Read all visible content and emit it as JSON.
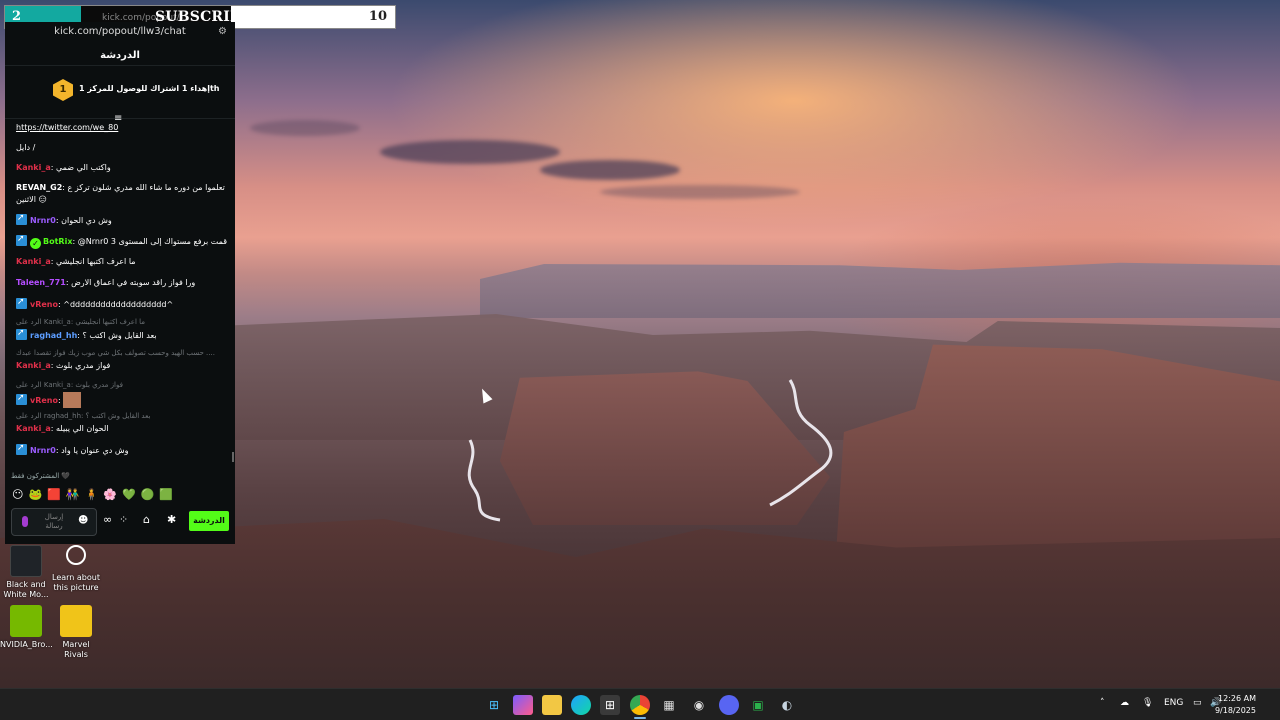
{
  "subscriber_bar": {
    "left_count": "2",
    "title": "SUBSCRIBERS",
    "right_count": "10",
    "progress": 0.2,
    "ghost_url": "kick.com/popout/..."
  },
  "chat": {
    "url": "kick.com/popout/llw3/chat",
    "header": "الدردشة",
    "goal_badge": "1",
    "goal_text": "إهداء 1 اشتراك للوصول للمركز 1th",
    "messages": [
      {
        "user": "",
        "user_color": "#ffffff",
        "text": "https://twitter.com/we_80",
        "badge": false
      },
      {
        "user": "",
        "user_color": "#ffffff",
        "text": "دايل /",
        "badge": false
      },
      {
        "user": "Kanki_a",
        "user_color": "#e0304a",
        "text": "واكتب الي ضمي",
        "badge": false
      },
      {
        "user": "REVAN_G2",
        "user_color": "#ffffff",
        "text": "تعلموا من دوره ما شاء الله مدري شلون تركز ع الاثنين 😑",
        "badge": false
      },
      {
        "user": "Nrnr0",
        "user_color": "#9b5cff",
        "text": "وش دي الحوان",
        "badge": true
      },
      {
        "user": "BotRix",
        "user_color": "#53fc18",
        "text": "@Nrnr0 3 قمت برفع مستواك إلى المستوى",
        "badge": true
      },
      {
        "user": "Kanki_a",
        "user_color": "#e0304a",
        "text": "ما اعرف اكتبها انجليشي",
        "badge": false
      },
      {
        "user": "Taleen_771",
        "user_color": "#b44dff",
        "text": "ورا فواز راقد سوبته في اعماق الارض",
        "badge": false
      },
      {
        "user": "vReno",
        "user_color": "#e0304a",
        "text": "^ddddddddddddddddddd^",
        "badge": true
      },
      {
        "user": "raghad_hh",
        "user_color": "#5c9dff",
        "text": "بعد القايل وش اكتب ؟",
        "badge": true,
        "reply": "الرد على Kanki_a: ما اعرف اكتبها انجليشي"
      },
      {
        "user": "Kanki_a",
        "user_color": "#e0304a",
        "text": "فواز مدري بلوث",
        "badge": false,
        "reply": "حسب الهيد وحسب تصولف بكل شي موب زيك فواز تقصدا عبدك ...."
      },
      {
        "user": "vReno",
        "user_color": "#e0304a",
        "text": "",
        "badge": true,
        "reply": "الرد على Kanki_a: فواز مدري بلوث"
      },
      {
        "user": "Kanki_a",
        "user_color": "#e0304a",
        "text": "الحوان الي يبيله",
        "badge": false,
        "reply": "الرد على raghad_hh: بعد القايل وش اكتب ؟"
      },
      {
        "user": "Nrnr0",
        "user_color": "#9b5cff",
        "text": "وش دي عنوان يا واد",
        "badge": true
      }
    ],
    "subscribers_only": "المشتركون فقط 🖤",
    "input_placeholder": "إرسال رسالة",
    "send_label": "الدردشة"
  },
  "desktop_icons": [
    {
      "label": "Black and White Mo...",
      "icon": "film-icon",
      "color": "#1f2328"
    },
    {
      "label": "Learn about this picture",
      "icon": "camera-icon",
      "color": "#00000000"
    },
    {
      "label": "NVIDIA_Bro...",
      "icon": "nvidia-icon",
      "color": "#76b900"
    },
    {
      "label": "Marvel Rivals",
      "icon": "game-icon",
      "color": "#f0c419"
    }
  ],
  "taskbar": {
    "language": "ENG",
    "time": "12:26 AM",
    "date": "9/18/2025"
  }
}
